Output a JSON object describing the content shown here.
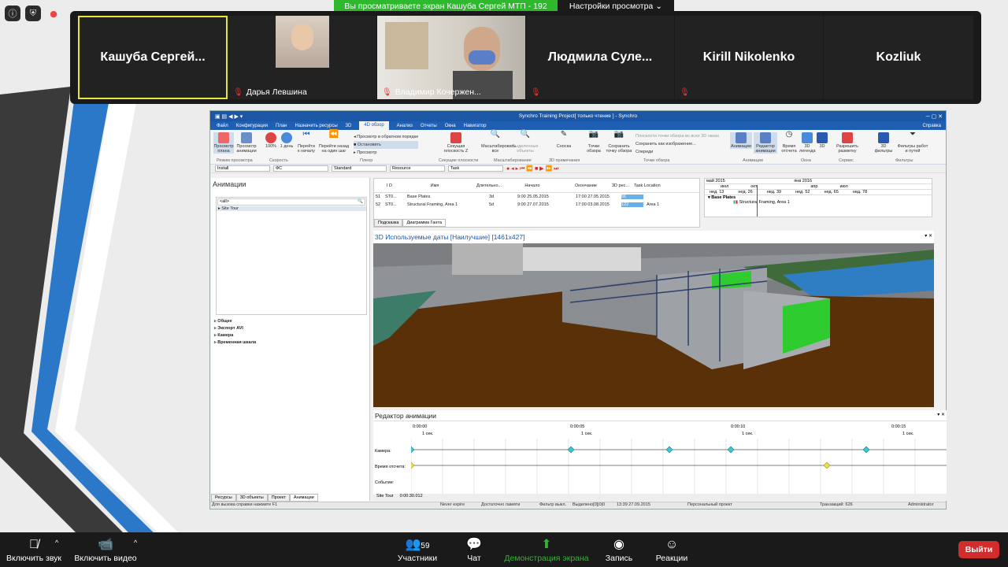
{
  "banner": {
    "sharing_text": "Вы просматриваете экран Кашуба Сергей МТП - 192",
    "view_settings": "Настройки просмотра"
  },
  "participants": [
    {
      "name": "Кашуба  Сергей...",
      "kind": "name-only",
      "highlighted": true
    },
    {
      "name": "Дарья Левшина",
      "kind": "video"
    },
    {
      "name": "Владимир Кочержен...",
      "kind": "video"
    },
    {
      "name": "Людмила  Суле...",
      "kind": "name-only"
    },
    {
      "name": "Kirill Nikolenko",
      "kind": "name-only"
    },
    {
      "name": "Kozliuk",
      "kind": "name-only"
    }
  ],
  "synchro": {
    "title": "Synchro Training Project[ только чтение ] - Synchro",
    "menu": [
      "Файл",
      "Конфигурация",
      "План",
      "Назначить ресурсы",
      "3D",
      "4D обзор",
      "Анализ",
      "Отчеты",
      "Окна",
      "Навигатор"
    ],
    "menu_active": "4D обзор",
    "menu_right": "Справка",
    "ribbon": {
      "b1": "Просмотр плана",
      "b2": "Просмотр анимации",
      "g1": "Режим просмотра",
      "speed_pct": "100%",
      "speed_day": "1 день",
      "g2": "Скорость",
      "b3": "Перейти к началу",
      "b4": "Перейти назад на один шаг",
      "rev": "Просмотр в обратном порядке",
      "stop": "Остановить",
      "play": "Просмотр",
      "g3": "Плеер",
      "b5": "Секущая плоскость Z",
      "g4": "Секущие плоскости",
      "b6": "Масштабировать все",
      "b7": "Выделенные объекты",
      "g5": "Масштабирование",
      "b8": "Сноска",
      "g6": "3D примечания",
      "b9": "Точки обзора",
      "b10": "Сохранить точку обзора",
      "vp1": "Плоскости точки обзора во всех 3D окнах",
      "vp2": "Сохранить как изображение...",
      "vp3": "Спереди",
      "g7": "Точки обзора",
      "b11": "Анимации",
      "b12": "Редактор анимации",
      "g8": "Анимации",
      "b13": "Время отсчета",
      "b14": "3D легенда",
      "b15": "3D",
      "g9": "Окна",
      "b16": "Разрешить разметку",
      "g10": "Сервис",
      "b17": "3D фильтры",
      "b18": "Фильтры работ и путей",
      "g11": "Фильтры"
    },
    "filters": [
      "Install",
      "ФС",
      "Standard",
      "Resource",
      "Task"
    ],
    "animations_panel": {
      "title": "Анимации",
      "search": "<all>",
      "tree_item": "Site Tour",
      "props": [
        "Общее",
        "Экспорт AVI",
        "Камера",
        "Временная шкала"
      ],
      "tabs": [
        "Ресурсы",
        "3D объекты",
        "Проект",
        "Анимации"
      ]
    },
    "grid": {
      "headers": [
        "I D",
        "Имя",
        "Длительно...",
        "Начало",
        "Окончание",
        "3D рес...",
        "Task Location"
      ],
      "rows": [
        [
          "51",
          "ST0...",
          "Base Plates",
          "3d",
          "9:00 25.05.2015",
          "17:00 27.05.2015",
          "56",
          ""
        ],
        [
          "52",
          "ST0...",
          "Structural Framing, Area 1",
          "5d",
          "9:00 27.07.2015",
          "17:00 03.08.2015",
          "122",
          "Area 1"
        ]
      ],
      "tabs": [
        "Подсказка",
        "Диаграмма Ганта"
      ]
    },
    "gantt": {
      "y1": "май 2015",
      "y2": "янв 2016",
      "months": [
        "июл",
        "окт",
        "апр",
        "июл"
      ],
      "weeks": [
        "нед. 13",
        "нед. 26",
        "нед. 39",
        "нед. 52",
        "нед. 65",
        "нед. 78"
      ],
      "row1": "Base Plates",
      "row2": "Structural Framing, Area 1"
    },
    "view3d": {
      "title": "3D Используемые даты [Наилучшие] [1461x427]"
    },
    "anim_editor": {
      "title": "Редактор анимации",
      "times": [
        "0:00:00",
        "0:00:05",
        "0:00:10",
        "0:00:15"
      ],
      "sec": "1 сек.",
      "rows": [
        "Камера:",
        "Время отсчета:",
        "Событие:"
      ],
      "site": "Site Tour",
      "time": "0:00:30.012"
    },
    "status": {
      "help": "Для вызова справки нажмите F1",
      "s1": "Never expire",
      "s2": "Достаточно памяти",
      "s3": "Фильтр выкл.",
      "s4": "Выделено[0]|0|0",
      "s5": "13:39 27.09.2015",
      "s6": "Персональный проект",
      "s7": "Транзакций: 626",
      "s8": "Administrator"
    }
  },
  "bottom": {
    "mute": "Включить звук",
    "video": "Включить видео",
    "participants": "Участники",
    "participants_count": "59",
    "chat": "Чат",
    "share": "Демонстрация экрана",
    "record": "Запись",
    "reactions": "Реакции",
    "exit": "Выйти"
  },
  "colors": {
    "zoom_green": "#2eb82e",
    "exit_red": "#d32c2c",
    "synchro_blue": "#1f5fb3"
  }
}
